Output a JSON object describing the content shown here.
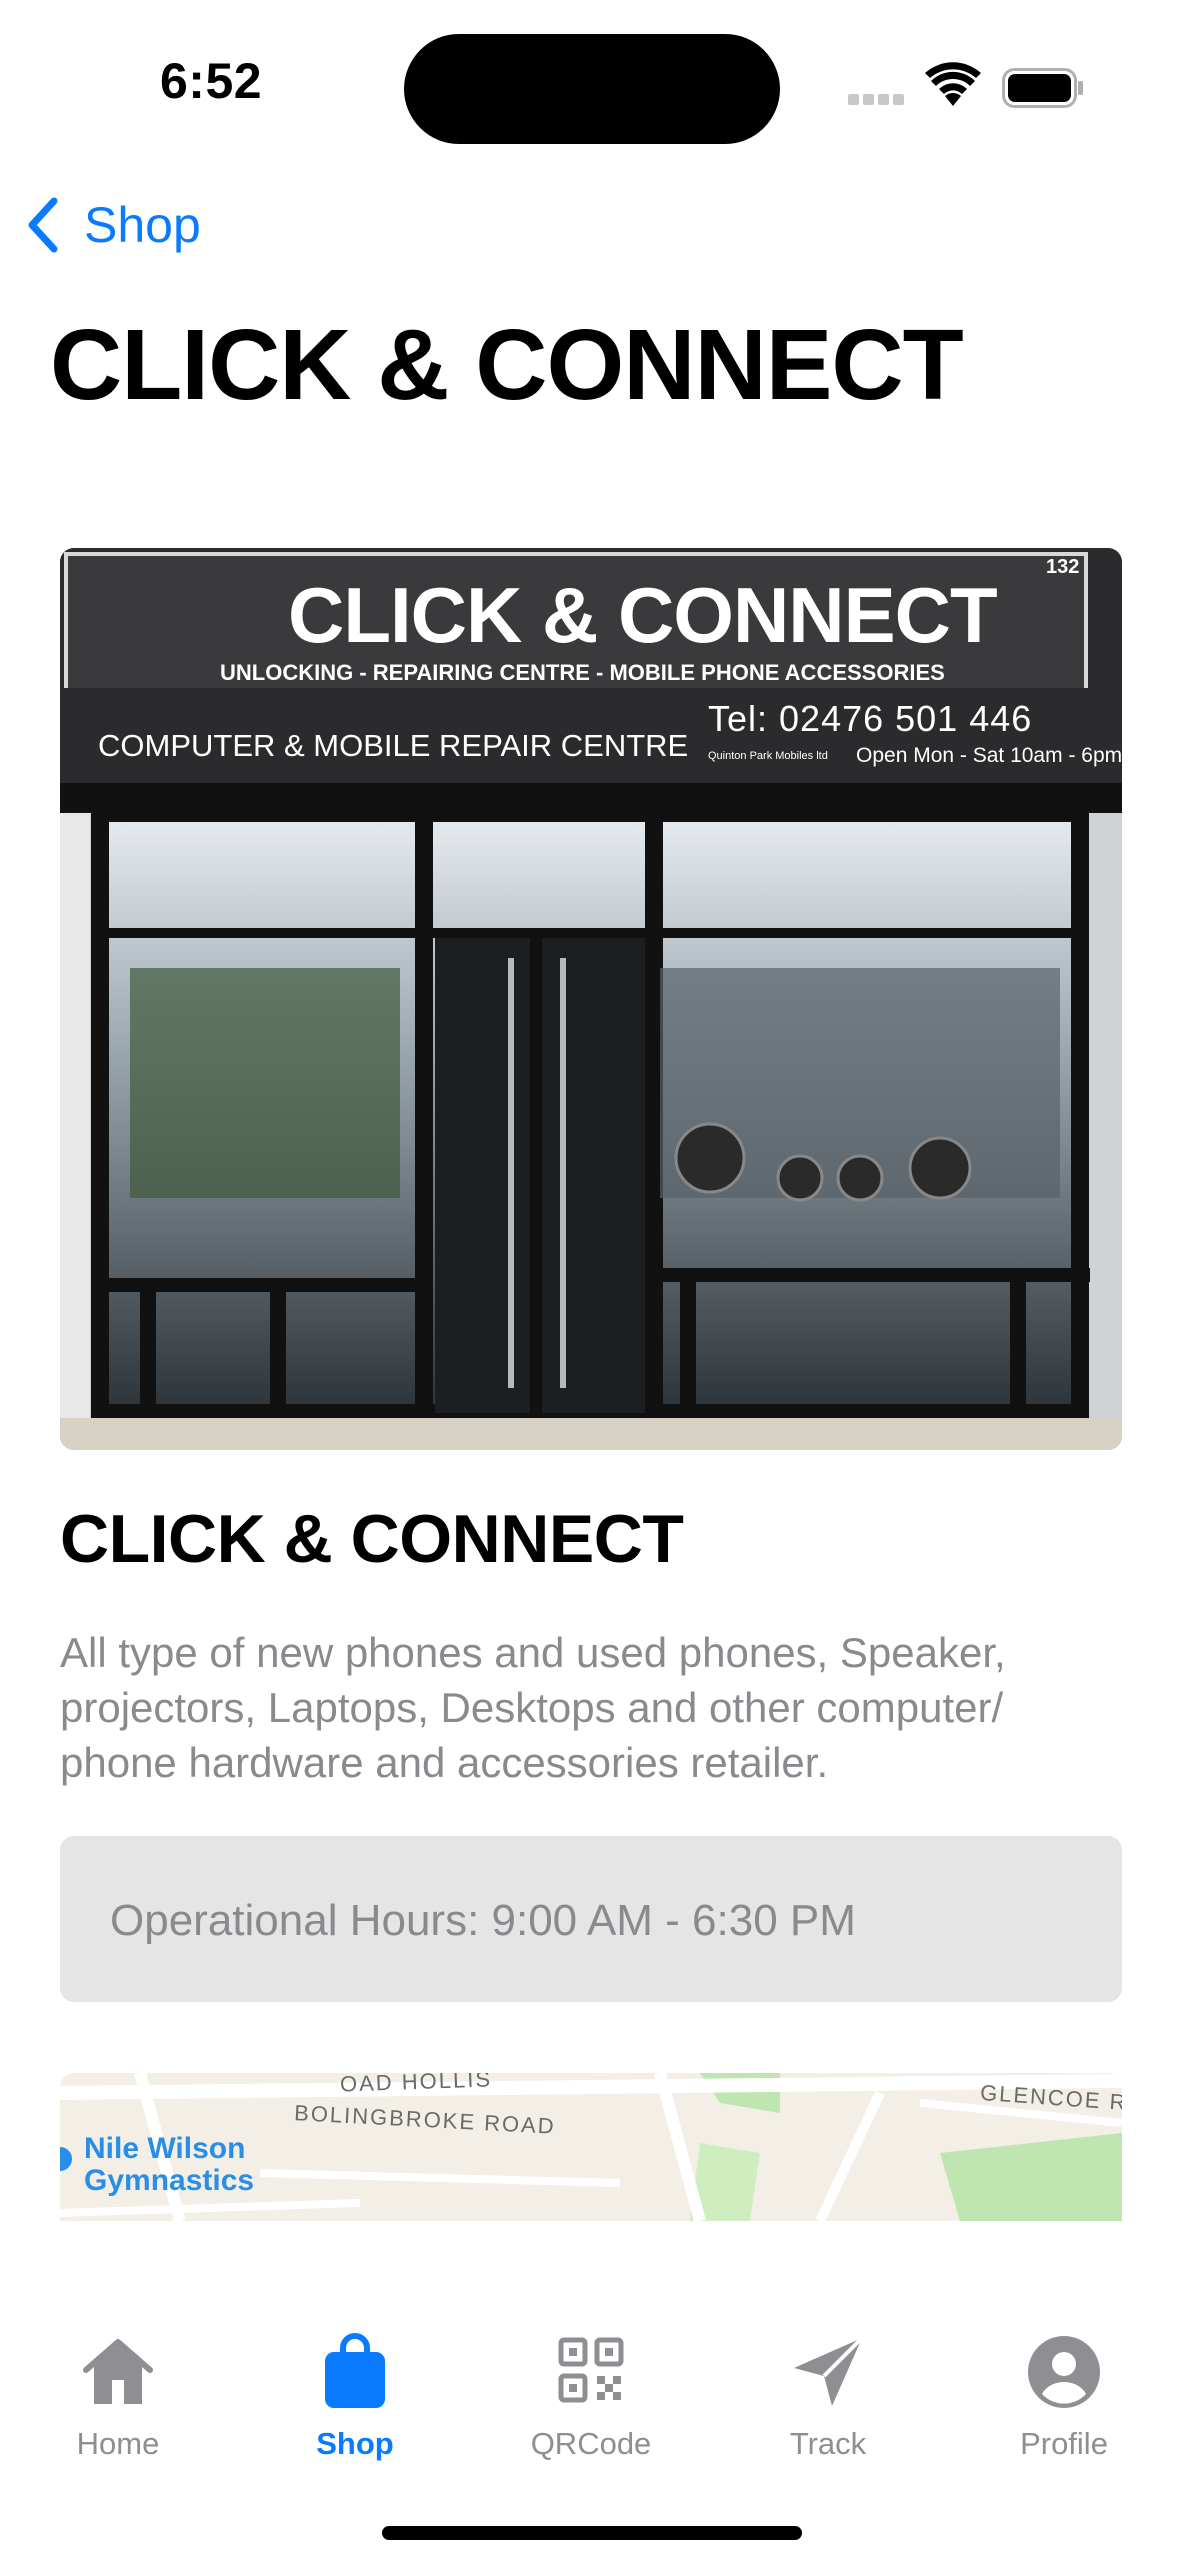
{
  "status_bar": {
    "time": "6:52",
    "icons": [
      "cellular-signal-icon",
      "wifi-icon",
      "battery-icon"
    ]
  },
  "nav": {
    "back_label": "Shop",
    "title": "CLICK & CONNECT"
  },
  "shop": {
    "photo_sign": {
      "name": "CLICK & CONNECT",
      "tagline": "UNLOCKING - REPAIRING CENTRE - MOBILE PHONE ACCESSORIES",
      "subtitle": "COMPUTER & MOBILE REPAIR CENTRE",
      "phone": "Tel: 02476 501 446",
      "hours": "Open Mon - Sat 10am - 6pm",
      "small_print": "Quinton  Park Mobiles ltd",
      "number": "132"
    },
    "name": "CLICK & CONNECT",
    "description": "All  type of new phones and used phones, Speaker, projectors, Laptops, Desktops and other computer/ phone hardware and accessories retailer.",
    "hours": "Operational Hours: 9:00 AM - 6:30 PM"
  },
  "map": {
    "roads": [
      "BOLINGBROKE ROAD",
      "GLENCOE R",
      "OAD  HOLLIS"
    ],
    "poi": "Nile Wilson Gymnastics",
    "poi_lines": [
      "Nile Wilson",
      "Gymnastics"
    ]
  },
  "tabs": [
    {
      "label": "Home",
      "icon": "house-icon",
      "active": false
    },
    {
      "label": "Shop",
      "icon": "shopping-bag-icon",
      "active": true
    },
    {
      "label": "QRCode",
      "icon": "qrcode-icon",
      "active": false
    },
    {
      "label": "Track",
      "icon": "paper-plane-icon",
      "active": false
    },
    {
      "label": "Profile",
      "icon": "person-circle-icon",
      "active": false
    }
  ],
  "colors": {
    "accent": "#0a7aff",
    "inactive": "#8e8e93",
    "secondary_text": "#8a8a8e",
    "card_background": "#e5e5e5"
  }
}
